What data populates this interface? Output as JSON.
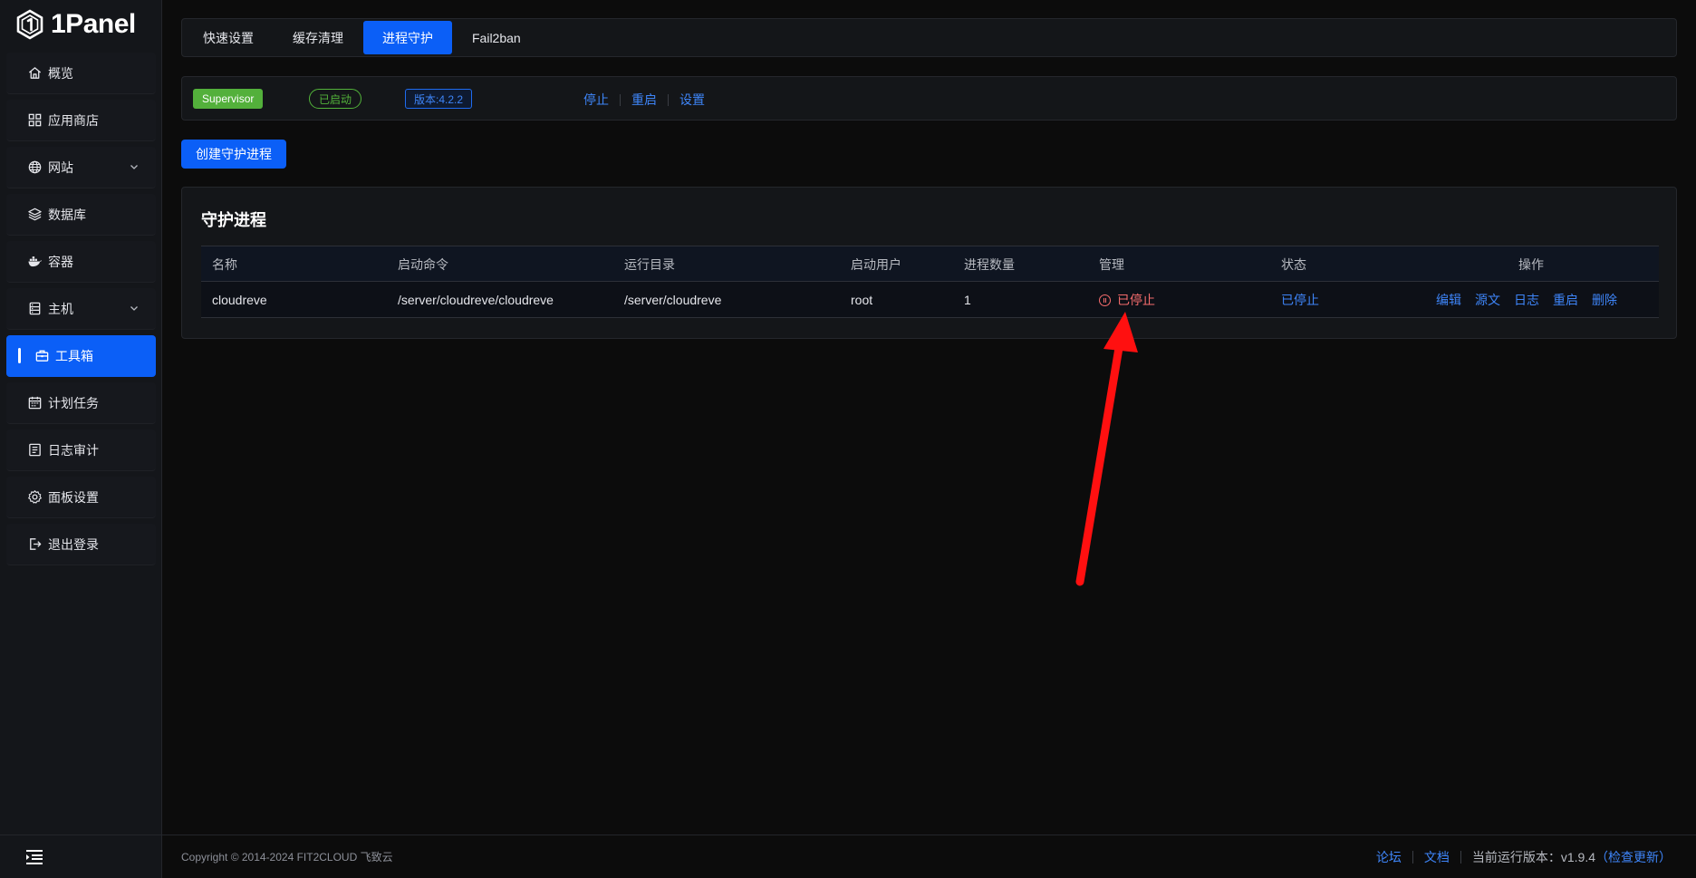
{
  "brand": {
    "name": "1Panel"
  },
  "sidebar": {
    "items": [
      {
        "label": "概览",
        "icon": "home-icon",
        "active": false
      },
      {
        "label": "应用商店",
        "icon": "grid-icon",
        "active": false
      },
      {
        "label": "网站",
        "icon": "globe-icon",
        "active": false,
        "expandable": true
      },
      {
        "label": "数据库",
        "icon": "layers-icon",
        "active": false
      },
      {
        "label": "容器",
        "icon": "docker-icon",
        "active": false
      },
      {
        "label": "主机",
        "icon": "server-icon",
        "active": false,
        "expandable": true
      },
      {
        "label": "工具箱",
        "icon": "toolbox-icon",
        "active": true
      },
      {
        "label": "计划任务",
        "icon": "calendar-icon",
        "active": false
      },
      {
        "label": "日志审计",
        "icon": "log-icon",
        "active": false
      },
      {
        "label": "面板设置",
        "icon": "gear-icon",
        "active": false
      },
      {
        "label": "退出登录",
        "icon": "logout-icon",
        "active": false
      }
    ],
    "collapse_icon": "menu-collapse-icon"
  },
  "tabs": [
    {
      "label": "快速设置",
      "active": false
    },
    {
      "label": "缓存清理",
      "active": false
    },
    {
      "label": "进程守护",
      "active": true
    },
    {
      "label": "Fail2ban",
      "active": false
    }
  ],
  "status_bar": {
    "service": "Supervisor",
    "state": "已启动",
    "version": "版本:4.2.2",
    "actions": [
      "停止",
      "重启",
      "设置"
    ]
  },
  "create_button": "创建守护进程",
  "process_table": {
    "title": "守护进程",
    "columns": [
      "名称",
      "启动命令",
      "运行目录",
      "启动用户",
      "进程数量",
      "管理",
      "状态",
      "操作"
    ],
    "rows": [
      {
        "name": "cloudreve",
        "command": "/server/cloudreve/cloudreve",
        "directory": "/server/cloudreve",
        "user": "root",
        "count": "1",
        "manage": "已停止",
        "status": "已停止",
        "actions": [
          "编辑",
          "源文",
          "日志",
          "重启",
          "删除"
        ]
      }
    ]
  },
  "footer": {
    "copyright": "Copyright © 2014-2024 FIT2CLOUD 飞致云",
    "forum": "论坛",
    "docs": "文档",
    "version_label": "当前运行版本：v1.9.4",
    "check_update": "（检查更新）"
  },
  "colors": {
    "accent": "#0b5ff7",
    "link": "#3e85f8",
    "success": "#53b03b",
    "danger": "#f56c6c",
    "annotation_arrow": "#ff1010"
  }
}
